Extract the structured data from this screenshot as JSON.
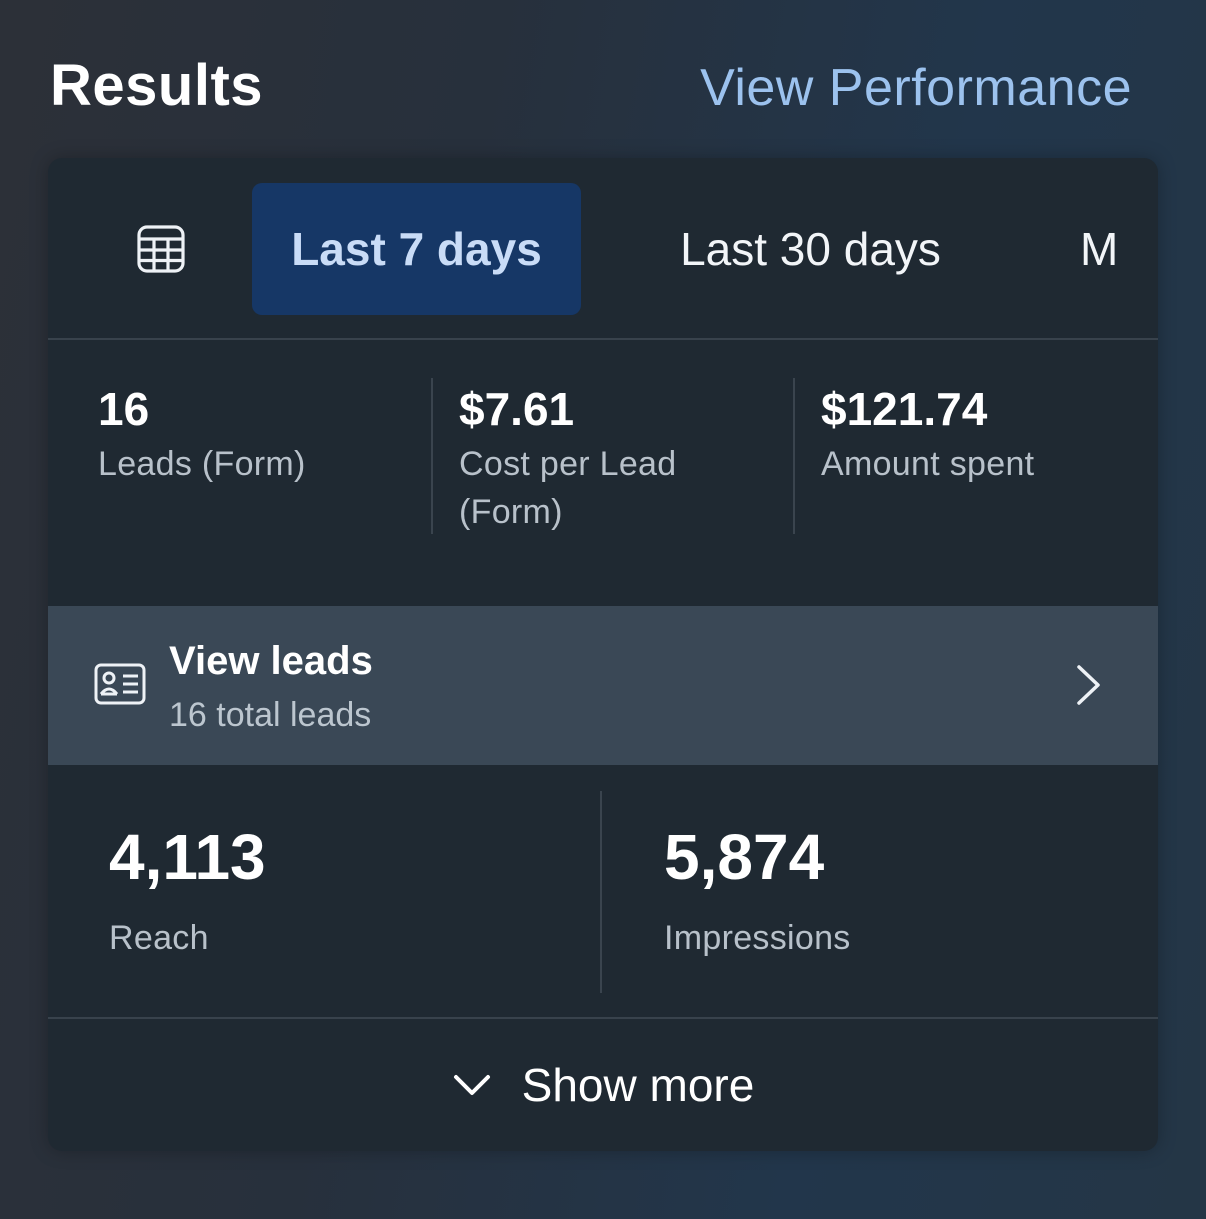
{
  "header": {
    "title": "Results",
    "view_performance": "View Performance"
  },
  "tabs": {
    "icon": "calendar-icon",
    "items": [
      {
        "label": "Last 7 days",
        "active": true
      },
      {
        "label": "Last 30 days",
        "active": false
      },
      {
        "label": "M",
        "active": false
      }
    ]
  },
  "stats": [
    {
      "value": "16",
      "label": "Leads (Form)"
    },
    {
      "value": "$7.61",
      "label": "Cost per Lead (Form)"
    },
    {
      "value": "$121.74",
      "label": "Amount spent"
    }
  ],
  "view_leads": {
    "icon": "contact-card-icon",
    "title": "View leads",
    "subtitle": "16 total leads",
    "chevron": "chevron-right-icon"
  },
  "metrics": [
    {
      "value": "4,113",
      "label": "Reach"
    },
    {
      "value": "5,874",
      "label": "Impressions"
    }
  ],
  "show_more": {
    "icon": "chevron-down-icon",
    "label": "Show more"
  },
  "colors": {
    "accent_link": "#9cc2ee",
    "active_tab_bg": "#163766",
    "card_bg": "#1f2932",
    "row_highlight": "#3a4856"
  }
}
